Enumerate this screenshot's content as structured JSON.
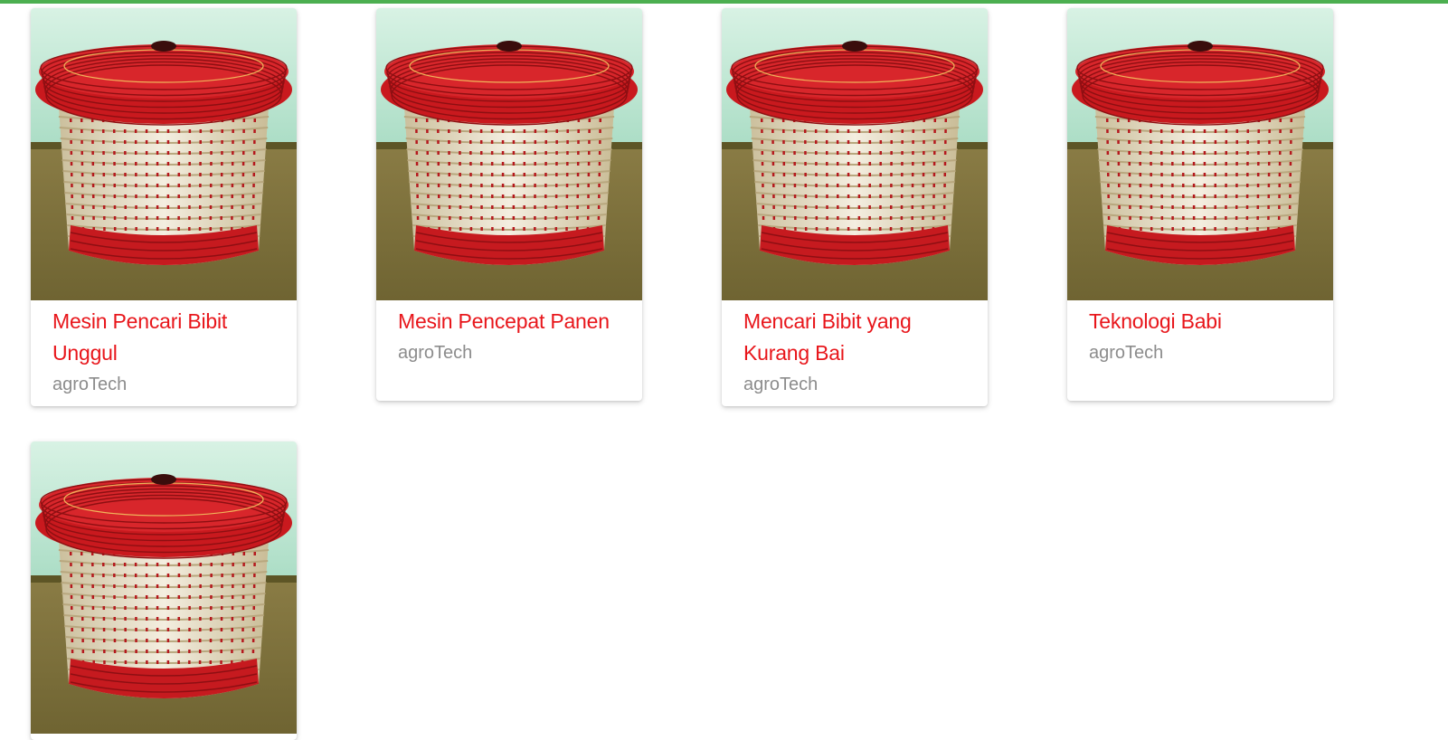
{
  "accent_color": "#4caf50",
  "title_color": "#e8161b",
  "author_color": "#8c8c8c",
  "image_icon": "woven-basket-image",
  "cards": [
    {
      "title": "Mesin Pencari Bibit Unggul",
      "author": "agroTech"
    },
    {
      "title": "Mesin Pencepat Panen",
      "author": "agroTech"
    },
    {
      "title": "Mencari Bibit yang Kurang Bai",
      "author": "agroTech"
    },
    {
      "title": "Teknologi Babi",
      "author": "agroTech"
    },
    {
      "title": "",
      "author": ""
    }
  ]
}
